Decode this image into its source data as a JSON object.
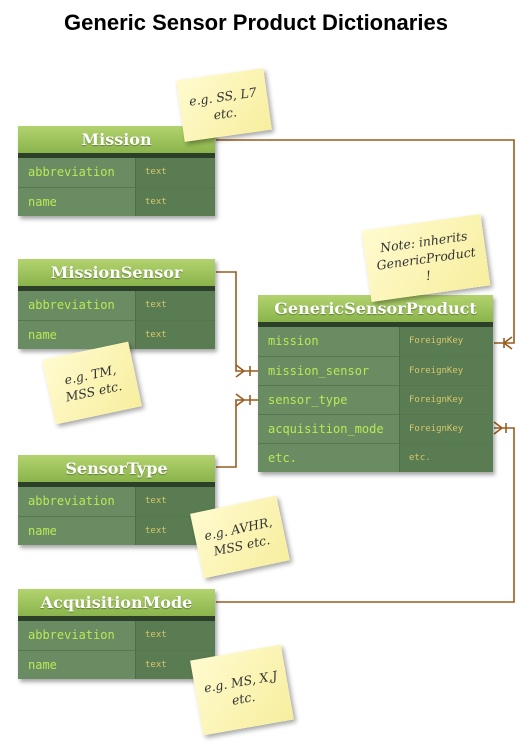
{
  "title": "Generic Sensor Product Dictionaries",
  "tables": {
    "mission": {
      "name": "Mission",
      "fields": [
        {
          "name": "abbreviation",
          "type": "text"
        },
        {
          "name": "name",
          "type": "text"
        }
      ]
    },
    "mission_sensor": {
      "name": "MissionSensor",
      "fields": [
        {
          "name": "abbreviation",
          "type": "text"
        },
        {
          "name": "name",
          "type": "text"
        }
      ]
    },
    "sensor_type": {
      "name": "SensorType",
      "fields": [
        {
          "name": "abbreviation",
          "type": "text"
        },
        {
          "name": "name",
          "type": "text"
        }
      ]
    },
    "acquisition_mode": {
      "name": "AcquisitionMode",
      "fields": [
        {
          "name": "abbreviation",
          "type": "text"
        },
        {
          "name": "name",
          "type": "text"
        }
      ]
    },
    "generic_sensor_product": {
      "name": "GenericSensorProduct",
      "fields": [
        {
          "name": "mission",
          "type": "ForeignKey"
        },
        {
          "name": "mission_sensor",
          "type": "ForeignKey"
        },
        {
          "name": "sensor_type",
          "type": "ForeignKey"
        },
        {
          "name": "acquisition_mode",
          "type": "ForeignKey"
        },
        {
          "name": "etc.",
          "type": "etc."
        }
      ]
    }
  },
  "notes": {
    "mission": [
      "e.g. SS, L7",
      "etc."
    ],
    "generic": [
      "Note: inherits",
      "GenericProduct",
      "!"
    ],
    "mission_sensor": [
      "e.g. TM,",
      "MSS etc."
    ],
    "sensor_type": [
      "e.g. AVHR,",
      "MSS etc."
    ],
    "acquisition_mode": [
      "e.g. MS, X,J",
      "etc."
    ]
  },
  "colors": {
    "connector": "#9a5b1e",
    "header": "#9cc35a",
    "field_text": "#b7ea55",
    "type_text": "#d6c76a"
  }
}
